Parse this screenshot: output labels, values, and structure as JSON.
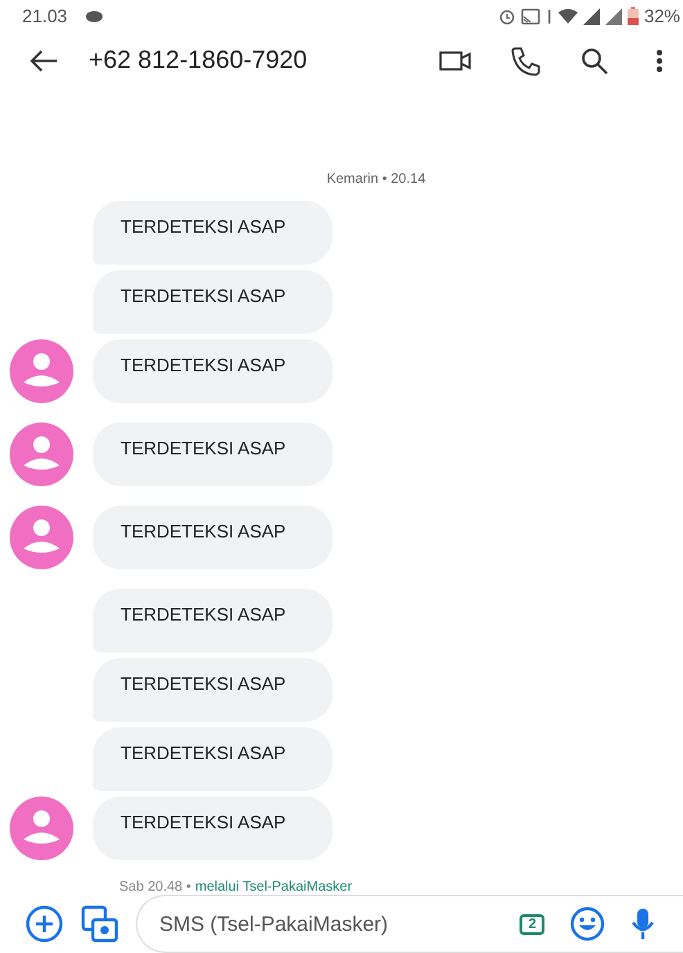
{
  "status_bar": {
    "time": "21.03",
    "battery": "32%"
  },
  "header": {
    "title": "+62 812-1860-7920"
  },
  "timestamp": "Kemarin • 20.14",
  "messages": [
    {
      "text": "TERDETEKSI ASAP",
      "avatar": false
    },
    {
      "text": "TERDETEKSI ASAP",
      "avatar": false
    },
    {
      "text": "TERDETEKSI ASAP",
      "avatar": true
    },
    {
      "text": "TERDETEKSI ASAP",
      "avatar": true
    },
    {
      "text": "TERDETEKSI ASAP",
      "avatar": true
    },
    {
      "text": "TERDETEKSI ASAP",
      "avatar": false
    },
    {
      "text": "TERDETEKSI ASAP",
      "avatar": false
    },
    {
      "text": "TERDETEKSI ASAP",
      "avatar": false
    },
    {
      "text": "TERDETEKSI ASAP",
      "avatar": true
    }
  ],
  "footer": {
    "time": "Sab 20.48 •",
    "via": "melalui Tsel-PakaiMasker"
  },
  "composer": {
    "placeholder": "SMS (Tsel-PakaiMasker)",
    "sim": "2"
  }
}
